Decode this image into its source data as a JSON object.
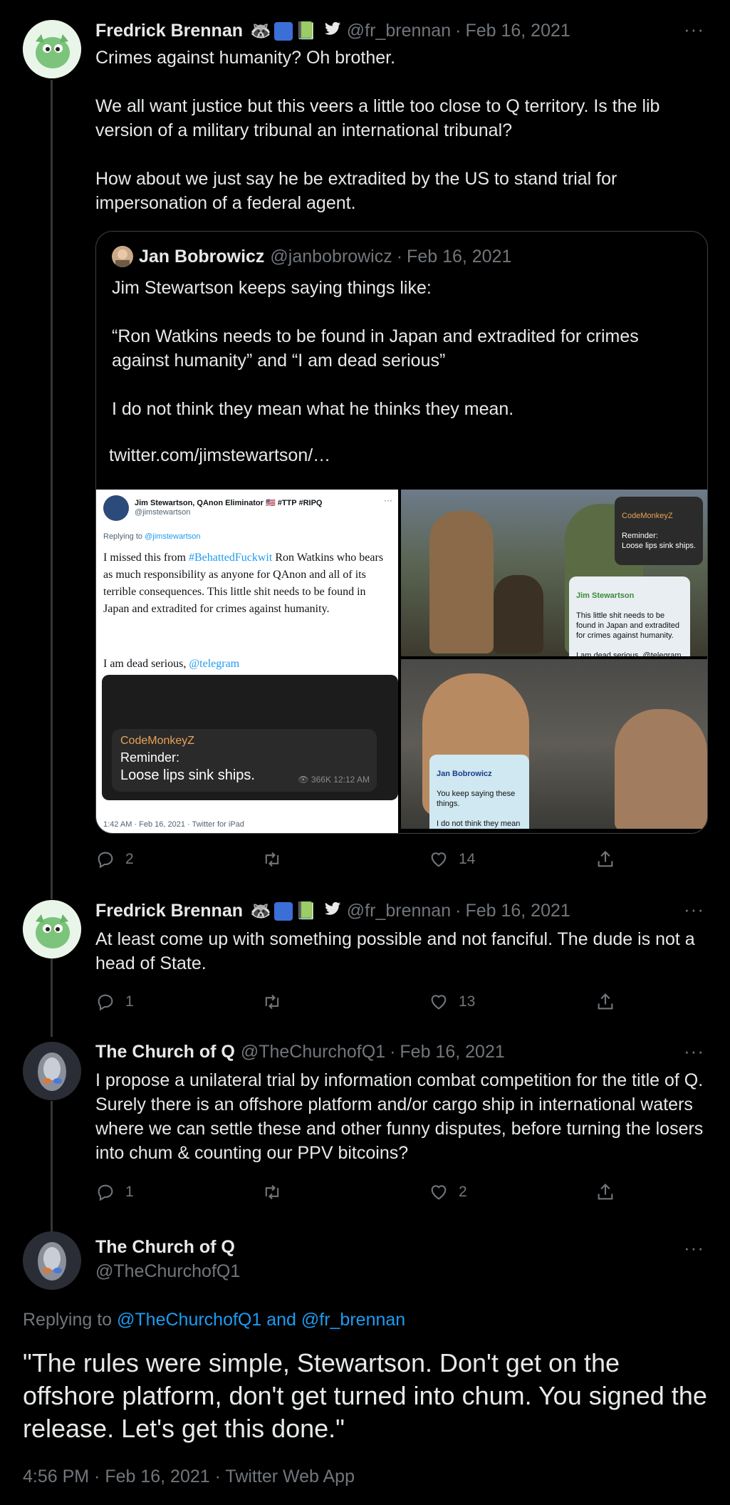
{
  "tweets": [
    {
      "name": "Fredrick Brennan",
      "handle": "@fr_brennan",
      "date": "Feb 16, 2021",
      "text": "Crimes against humanity? Oh brother.\n\nWe all want justice but this veers a little too close to Q territory. Is the lib version of a military tribunal an international tribunal?\n\nHow about we just say he be extradited by the US to stand trial for impersonation of a federal agent.",
      "replies": "2",
      "retweets": "",
      "likes": "14",
      "icons": [
        "raccoon-emoji",
        "symbols-emoji",
        "green-book-emoji",
        "bird-icon"
      ]
    },
    {
      "name": "Fredrick Brennan",
      "handle": "@fr_brennan",
      "date": "Feb 16, 2021",
      "text": "At least come up with something possible and not fanciful. The dude is not a head of State.",
      "replies": "1",
      "retweets": "",
      "likes": "13"
    },
    {
      "name": "The Church of Q",
      "handle": "@TheChurchofQ1",
      "date": "Feb 16, 2021",
      "text": "I propose a unilateral trial by information combat competition for the title of Q. Surely there is an offshore platform and/or cargo ship in international waters where we can settle these and other funny disputes, before turning the losers into chum & counting our PPV bitcoins?",
      "replies": "1",
      "retweets": "",
      "likes": "2"
    }
  ],
  "quote": {
    "name": "Jan Bobrowicz",
    "handle": "@janbobrowicz",
    "date": "Feb 16, 2021",
    "text": "Jim Stewartson keeps saying things like:\n\n“Ron Watkins needs to be found in Japan and extradited for crimes against humanity” and “I am dead serious”\n\nI do not think they mean what he thinks they mean.",
    "link": "twitter.com/jimstewartson/…",
    "screenshot": {
      "name": "Jim Stewartson, QAnon Eliminator 🇺🇸 #TTP #RIPQ",
      "handle": "@jimstewartson",
      "replying_prefix": "Replying to",
      "replying_to": "@jimstewartson",
      "text_before": "I missed this from",
      "hashtag": "#BehattedFuckwit",
      "text_after": "Ron Watkins who bears as much responsibility as anyone for QAnon and all of its terrible consequences. This little shit needs to be found in Japan and extradited for crimes against humanity.",
      "text_2": "I am dead serious,",
      "mention": "@telegram",
      "tg_sender": "CodeMonkeyZ",
      "tg_line1": "Reminder:",
      "tg_line2": "Loose lips sink ships.",
      "tg_views": "366K",
      "tg_time": "12:12 AM",
      "footer": "1:42 AM · Feb 16, 2021 · Twitter for iPad"
    },
    "meme": {
      "top_sticker_name": "CodeMonkeyZ",
      "top_sticker_text": "Reminder:\nLoose lips sink ships.",
      "mid_sticker_name": "Jim Stewartson",
      "mid_sticker_text": "This little shit needs to be found in Japan and extradited for crimes against humanity.\n\nI am dead serious, @telegram",
      "bottom_sticker_name": "Jan Bobrowicz",
      "bottom_sticker_text": "You keep saying these things.\n\nI do not think they mean what you think they mean."
    }
  },
  "main": {
    "name": "The Church of Q",
    "handle": "@TheChurchofQ1",
    "replying_prefix": "Replying to",
    "replying_to": "@TheChurchofQ1 and @fr_brennan",
    "text": "\"The rules were simple, Stewartson. Don't get on the offshore platform, don't get turned into chum. You signed the release. Let's get this done.\"",
    "timestamp": "4:56 PM · Feb 16, 2021 · Twitter Web App"
  },
  "more_label": "···",
  "separator": "·",
  "colors": {
    "background": "#000000",
    "text": "#e7e9ea",
    "muted": "#71767b",
    "link": "#1d9bf0",
    "border": "#333639"
  }
}
